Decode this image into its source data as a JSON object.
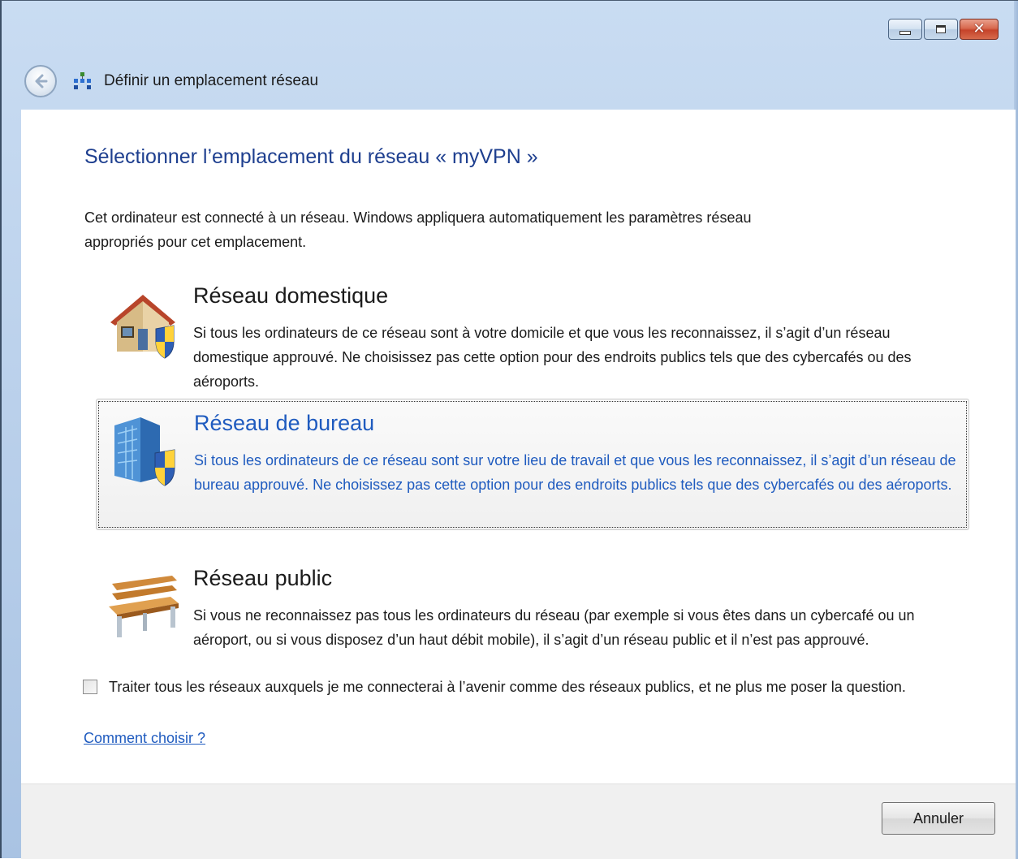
{
  "window": {
    "title": "Définir un emplacement réseau",
    "caption_buttons": {
      "minimize_icon": "minimize-icon",
      "maximize_icon": "maximize-icon",
      "close_icon": "close-icon"
    },
    "close_glyph": "✕"
  },
  "main": {
    "heading": "Sélectionner l’emplacement du réseau « myVPN »",
    "description": "Cet ordinateur est connecté à un réseau. Windows appliquera automatiquement les paramètres réseau appropriés pour cet emplacement.",
    "options": [
      {
        "icon": "home-network-icon",
        "title": "Réseau domestique",
        "text": "Si tous les ordinateurs de ce réseau sont à votre domicile et que vous les reconnaissez, il s’agit d’un réseau domestique approuvé. Ne choisissez pas cette option pour des endroits publics tels que des cybercafés ou des aéroports."
      },
      {
        "icon": "work-network-icon",
        "title": "Réseau de bureau",
        "text": "Si tous les ordinateurs de ce réseau sont sur votre lieu de travail et que vous les reconnaissez, il s’agit d’un réseau de bureau approuvé. Ne choisissez pas cette option pour des endroits publics tels que des cybercafés ou des aéroports.",
        "selected": true
      },
      {
        "icon": "public-network-icon",
        "title": "Réseau public",
        "text": "Si vous ne reconnaissez pas tous les ordinateurs du réseau (par exemple si vous êtes dans un cybercafé ou un aéroport, ou si vous disposez d’un haut débit mobile), il s’agit d’un réseau public et il n’est pas approuvé."
      }
    ],
    "checkbox_label": "Traiter tous les réseaux auxquels je me connecterai à l’avenir comme des réseaux publics, et ne plus me poser la question.",
    "checkbox_checked": false,
    "help_link": "Comment choisir ?"
  },
  "footer": {
    "cancel_label": "Annuler"
  },
  "colors": {
    "heading": "#1e3f8f",
    "selected_text": "#1f5bbf",
    "link": "#1f5bbf"
  }
}
